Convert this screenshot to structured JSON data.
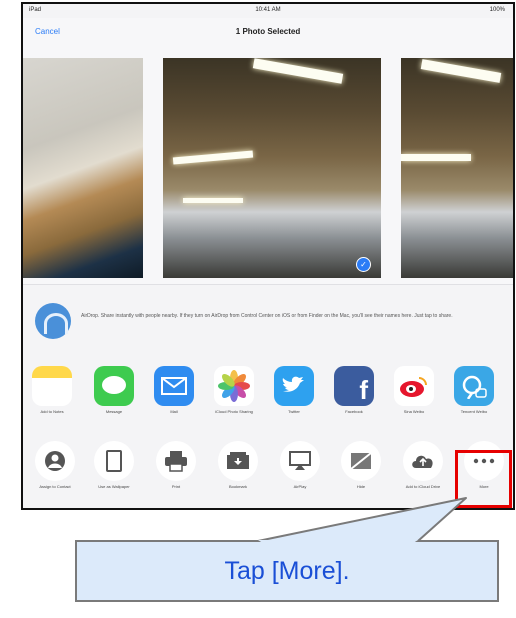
{
  "status_bar": {
    "left": "iPad",
    "time": "10:41 AM",
    "battery": "100%"
  },
  "nav": {
    "cancel_label": "Cancel",
    "title": "1 Photo Selected"
  },
  "airdrop": {
    "icon": "airdrop-icon",
    "text": "AirDrop. Share instantly with people nearby. If they turn on AirDrop from Control Center on iOS or from Finder on the Mac, you'll see their names here. Just tap to share."
  },
  "apps": [
    {
      "label": "Add to Notes",
      "icon": "notes-icon",
      "color": "#ffd84a"
    },
    {
      "label": "Message",
      "icon": "message-icon",
      "color": "#3ecb4f"
    },
    {
      "label": "Mail",
      "icon": "mail-icon",
      "color": "#2f8cf0"
    },
    {
      "label": "iCloud Photo Sharing",
      "icon": "photos-icon",
      "color": "#ffffff"
    },
    {
      "label": "Twitter",
      "icon": "twitter-icon",
      "color": "#2ea1ef"
    },
    {
      "label": "Facebook",
      "icon": "facebook-icon",
      "color": "#3b5c9e"
    },
    {
      "label": "Sina Weibo",
      "icon": "weibo-icon",
      "color": "#ffffff"
    },
    {
      "label": "Tencent Weibo",
      "icon": "tencent-weibo-icon",
      "color": "#3aa7e6"
    }
  ],
  "actions": [
    {
      "label": "Assign to Contact",
      "icon": "contact-icon"
    },
    {
      "label": "Use as Wallpaper",
      "icon": "wallpaper-icon"
    },
    {
      "label": "Print",
      "icon": "print-icon"
    },
    {
      "label": "Bookmark",
      "icon": "bookmark-icon"
    },
    {
      "label": "AirPlay",
      "icon": "airplay-icon"
    },
    {
      "label": "Hide",
      "icon": "hide-icon"
    },
    {
      "label": "Add to iCloud Drive",
      "icon": "icloud-drive-icon"
    },
    {
      "label": "More",
      "icon": "more-icon"
    }
  ],
  "callout": {
    "text": "Tap [More]."
  },
  "colors": {
    "highlight": "#e60000",
    "accent": "#2b7cf6",
    "callout_bg": "#dceafa",
    "callout_text": "#1a4fd6"
  }
}
